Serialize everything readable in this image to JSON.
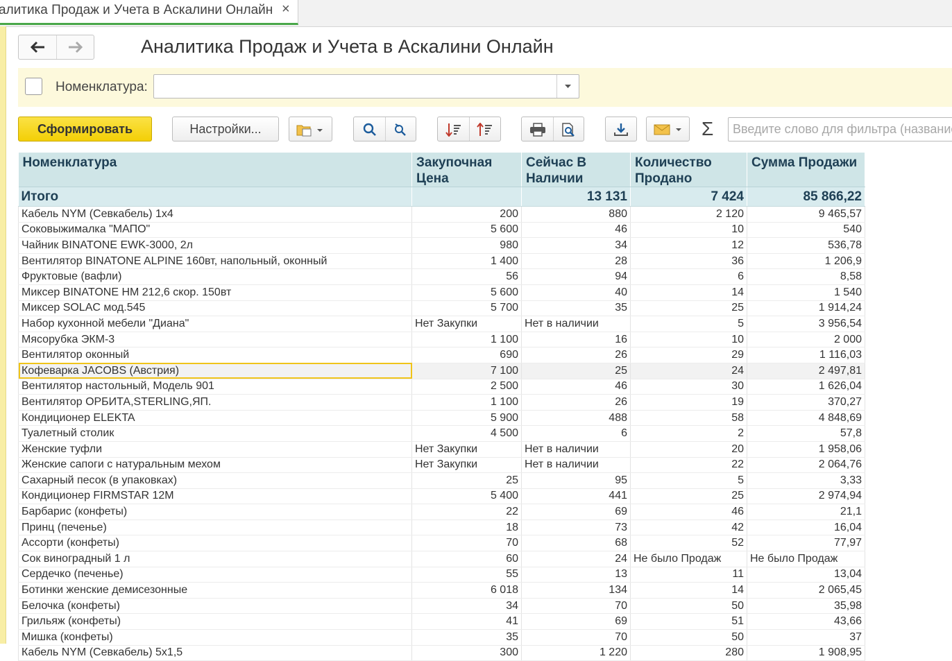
{
  "tab": {
    "title": "алитика Продаж и Учета в Аскалини Онлайн",
    "close": "×"
  },
  "page": {
    "title": "Аналитика Продаж и Учета в Аскалини Онлайн"
  },
  "filter": {
    "label": "Номенклатура:",
    "value": ""
  },
  "toolbar": {
    "generate": "Сформировать",
    "settings": "Настройки...",
    "sigma": "Σ",
    "search_placeholder": "Введите слово для фильтра (название"
  },
  "colors": {
    "accent_yellow": "#f5d30c",
    "header_bg": "#cfe5e7",
    "selection": "#f0c419"
  },
  "table": {
    "headers": [
      "Номенклатура",
      "Закупочная Цена",
      "Сейчас В Наличии",
      "Количество Продано",
      "Сумма Продажи"
    ],
    "total": {
      "label": "Итого",
      "stock": "13 131",
      "sold": "7 424",
      "sum": "85 866,22"
    },
    "selected_index": 10,
    "rows": [
      [
        "Кабель NYM (Севкабель) 1х4",
        "200",
        "880",
        "2 120",
        "9 465,57"
      ],
      [
        "Соковыжималка \"МАПО\"",
        "5 600",
        "46",
        "10",
        "540"
      ],
      [
        "Чайник BINATONE  EWK-3000,  2л",
        "980",
        "34",
        "12",
        "536,78"
      ],
      [
        "Вентилятор BINATONE ALPINE 160вт, напольный, оконный",
        "1 400",
        "28",
        "36",
        "1 206,9"
      ],
      [
        "Фруктовые (вафли)",
        "56",
        "94",
        "6",
        "8,58"
      ],
      [
        "Миксер BINATONE HM 212,6 скор. 150вт",
        "5 600",
        "40",
        "14",
        "1 540"
      ],
      [
        "Миксер SOLAC мод.545",
        "5 700",
        "35",
        "25",
        "1 914,24"
      ],
      [
        "Набор кухонной мебели \"Диана\"",
        "Нет Закупки",
        "Нет в наличии",
        "5",
        "3 956,54"
      ],
      [
        "Мясорубка ЭКМ-3",
        "1 100",
        "16",
        "10",
        "2 000"
      ],
      [
        "Вентилятор оконный",
        "690",
        "26",
        "29",
        "1 116,03"
      ],
      [
        "Кофеварка JACOBS (Австрия)",
        "7 100",
        "25",
        "24",
        "2 497,81"
      ],
      [
        "Вентилятор настольный, Модель 901",
        "2 500",
        "46",
        "30",
        "1 626,04"
      ],
      [
        "Вентилятор ОРБИТА,STERLING,ЯП.",
        "1 100",
        "26",
        "19",
        "370,27"
      ],
      [
        "Кондиционер ELEKTA",
        "5 900",
        "488",
        "58",
        "4 848,69"
      ],
      [
        "Туалетный столик",
        "4 500",
        "6",
        "2",
        "57,8"
      ],
      [
        "Женские туфли",
        "Нет Закупки",
        "Нет в наличии",
        "20",
        "1 958,06"
      ],
      [
        "Женские сапоги с натуральным мехом",
        "Нет Закупки",
        "Нет в наличии",
        "22",
        "2 064,76"
      ],
      [
        "Сахарный песок (в упаковках)",
        "25",
        "95",
        "5",
        "3,33"
      ],
      [
        "Кондиционер FIRMSTAR 12M",
        "5 400",
        "441",
        "25",
        "2 974,94"
      ],
      [
        "Барбарис (конфеты)",
        "22",
        "69",
        "46",
        "21,1"
      ],
      [
        "Принц (печенье)",
        "18",
        "73",
        "42",
        "16,04"
      ],
      [
        "Ассорти (конфеты)",
        "70",
        "68",
        "52",
        "77,97"
      ],
      [
        "Сок виноградный 1 л",
        "60",
        "24",
        "Не было Продаж",
        "Не было Продаж"
      ],
      [
        "Сердечко (печенье)",
        "55",
        "13",
        "11",
        "13,04"
      ],
      [
        "Ботинки женские демисезонные",
        "6 018",
        "134",
        "14",
        "2 065,45"
      ],
      [
        "Белочка (конфеты)",
        "34",
        "70",
        "50",
        "35,98"
      ],
      [
        "Грильяж (конфеты)",
        "41",
        "69",
        "51",
        "43,66"
      ],
      [
        "Мишка (конфеты)",
        "35",
        "70",
        "50",
        "37"
      ],
      [
        "Кабель NYM (Севкабель) 5х1,5",
        "300",
        "1 220",
        "280",
        "1 908,95"
      ]
    ]
  }
}
